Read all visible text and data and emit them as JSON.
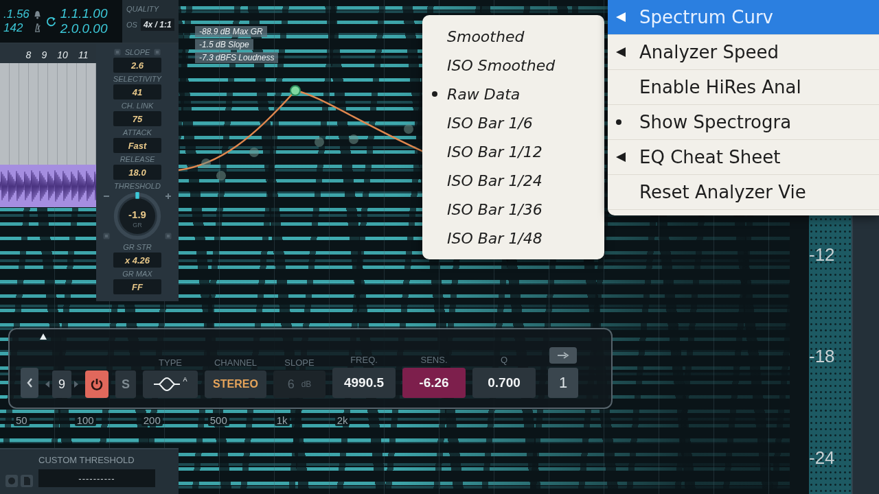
{
  "transport": {
    "position": ".1.56",
    "tempo": "142",
    "loop_start": "1.1.1.00",
    "loop_end": "2.0.0.00"
  },
  "quality": {
    "label": "QUALITY",
    "oversampling_label": "OS",
    "oversampling_value": "4x / 1:1"
  },
  "timeline": {
    "bar_numbers": [
      "8",
      "9",
      "10",
      "11"
    ]
  },
  "controls": [
    {
      "kind": "stepper",
      "label": "SLOPE",
      "value": "2.6"
    },
    {
      "kind": "field",
      "label": "SELECTIVITY",
      "value": "41"
    },
    {
      "kind": "field",
      "label": "CH. LINK",
      "value": "75"
    },
    {
      "kind": "field",
      "label": "ATTACK",
      "value": "Fast"
    },
    {
      "kind": "field",
      "label": "RELEASE",
      "value": "18.0"
    },
    {
      "kind": "knob",
      "label": "THRESHOLD",
      "value": "-1.9",
      "unit": "GR",
      "level": 0.5
    },
    {
      "kind": "field",
      "label": "GR STR",
      "value": "x 4.26"
    },
    {
      "kind": "field",
      "label": "GR MAX",
      "value": "FF"
    }
  ],
  "readouts": [
    "-88.9 dB Max GR",
    "-1.5 dB Slope",
    "-7.3 dBFS Loudness"
  ],
  "band": {
    "number": "9",
    "power_on": true,
    "solo": {
      "label": "S",
      "on": false
    },
    "type": {
      "label": "TYPE",
      "badge": "A"
    },
    "channel": {
      "label": "CHANNEL",
      "value": "STEREO"
    },
    "slope": {
      "label": "SLOPE",
      "value": "6",
      "unit": "dB",
      "disabled": true
    },
    "params": [
      {
        "label": "FREQ.",
        "value": "4990.5",
        "selected": false
      },
      {
        "label": "SENS.",
        "value": "-6.26",
        "selected": true
      },
      {
        "label": "Q",
        "value": "0.700",
        "selected": false
      }
    ],
    "page": "1"
  },
  "freq_axis": [
    "50",
    "100",
    "200",
    "500",
    "1k",
    "2k"
  ],
  "db_axis": [
    "-12",
    "-18",
    "-24"
  ],
  "custom_threshold": {
    "label": "CUSTOM THRESHOLD",
    "value": "----------"
  },
  "curve_menu": {
    "items": [
      {
        "label": "Smoothed",
        "selected": false
      },
      {
        "label": "ISO Smoothed",
        "selected": false
      },
      {
        "label": "Raw Data",
        "selected": true
      },
      {
        "label": "ISO Bar 1/6",
        "selected": false
      },
      {
        "label": "ISO Bar 1/12",
        "selected": false
      },
      {
        "label": "ISO Bar 1/24",
        "selected": false
      },
      {
        "label": "ISO Bar 1/36",
        "selected": false
      },
      {
        "label": "ISO Bar 1/48",
        "selected": false
      }
    ]
  },
  "context_menu": {
    "items": [
      {
        "label": "Spectrum Curv",
        "submenu": true,
        "selected": true,
        "checked": false
      },
      {
        "label": "Analyzer Speed",
        "submenu": true,
        "selected": false,
        "checked": false
      },
      {
        "label": "Enable HiRes Anal",
        "submenu": false,
        "selected": false,
        "checked": false
      },
      {
        "label": "Show Spectrogra",
        "submenu": false,
        "selected": false,
        "checked": true
      },
      {
        "label": "EQ Cheat Sheet",
        "submenu": true,
        "selected": false,
        "checked": false
      },
      {
        "label": "Reset Analyzer Vie",
        "submenu": false,
        "selected": false,
        "checked": false
      }
    ]
  }
}
